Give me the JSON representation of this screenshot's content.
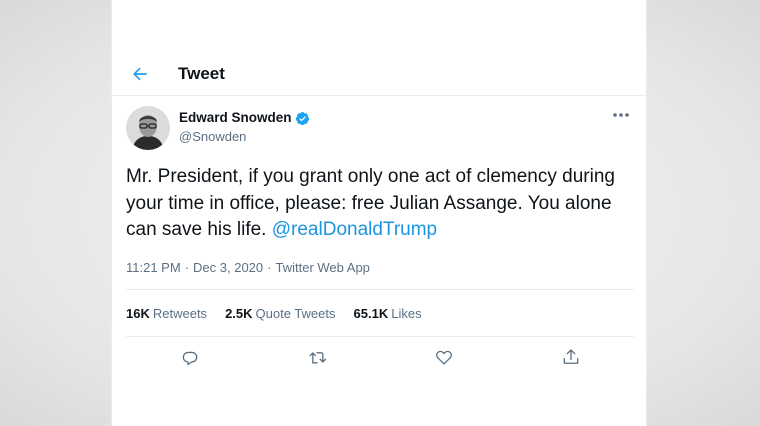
{
  "header": {
    "title": "Tweet"
  },
  "author": {
    "name": "Edward Snowden",
    "handle": "@Snowden"
  },
  "tweet": {
    "text": "Mr. President, if you grant only one act of clemency during your time in office, please: free Julian Assange. You alone can save his life. ",
    "mention": "@realDonaldTrump",
    "time": "11:21 PM",
    "date": "Dec 3, 2020",
    "source": "Twitter Web App",
    "separator": "·"
  },
  "stats": {
    "retweets": {
      "count": "16K",
      "label": "Retweets"
    },
    "quotes": {
      "count": "2.5K",
      "label": "Quote Tweets"
    },
    "likes": {
      "count": "65.1K",
      "label": "Likes"
    }
  },
  "icons": {
    "back": "arrow-left-icon",
    "verified": "verified-badge-icon",
    "more": "more-options-icon",
    "reply": "reply-icon",
    "retweet": "retweet-icon",
    "like": "heart-icon",
    "share": "share-icon"
  },
  "colors": {
    "accent": "#1da1f2",
    "mention": "#1b95e0",
    "muted": "#5b7083",
    "border": "#e6ecf0"
  }
}
